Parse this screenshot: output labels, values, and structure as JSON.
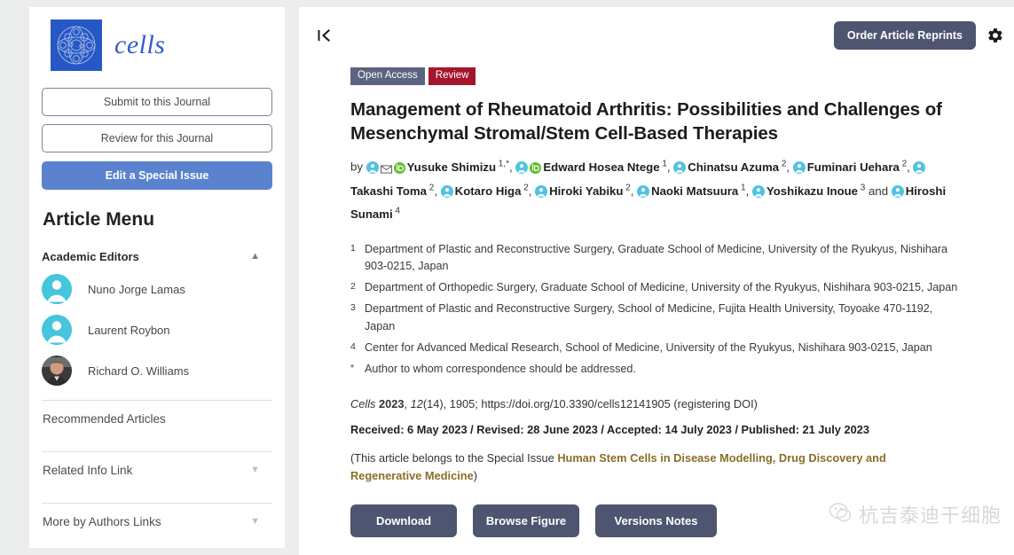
{
  "journal": {
    "logo_word": "cells",
    "logo_icon": "cell-cluster-logo"
  },
  "sidebar": {
    "buttons": {
      "submit": "Submit to this Journal",
      "review": "Review for this Journal",
      "edit_special_issue": "Edit a Special Issue"
    },
    "article_menu_title": "Article Menu",
    "academic_editors": {
      "label": "Academic Editors",
      "chevron": "chevron-up",
      "editors": [
        {
          "name": "Nuno Jorge Lamas",
          "avatar": "default-person-avatar"
        },
        {
          "name": "Laurent Roybon",
          "avatar": "default-person-avatar"
        },
        {
          "name": "Richard O. Williams",
          "avatar": "photo-avatar"
        }
      ]
    },
    "menu_links": [
      {
        "label": "Recommended Articles",
        "chevron": ""
      },
      {
        "label": "Related Info Link",
        "chevron": "chevron-down"
      },
      {
        "label": "More by Authors Links",
        "chevron": "chevron-down"
      }
    ]
  },
  "toolbar": {
    "collapse_icon": "collapse-left-icon",
    "reprints_label": "Order Article Reprints",
    "settings_icon": "gear-icon"
  },
  "article": {
    "badges": [
      {
        "label": "Open Access",
        "color": "#5a6480"
      },
      {
        "label": "Review",
        "color": "#a3162b"
      }
    ],
    "title": "Management of Rheumatoid Arthritis: Possibilities and Challenges of Mesenchymal Stromal/Stem Cell-Based Therapies",
    "by_label": "by",
    "authors": [
      {
        "name": "Yusuke Shimizu",
        "sup": "1,*",
        "icons": [
          "person-icon",
          "envelope-icon",
          "orcid-icon"
        ],
        "sep": ", "
      },
      {
        "name": "Edward Hosea Ntege",
        "sup": "1",
        "icons": [
          "person-icon",
          "orcid-icon"
        ],
        "sep": ", "
      },
      {
        "name": "Chinatsu Azuma",
        "sup": "2",
        "icons": [
          "person-icon"
        ],
        "sep": ", "
      },
      {
        "name": "Fuminari Uehara",
        "sup": "2",
        "icons": [
          "person-icon"
        ],
        "sep": ", "
      },
      {
        "name": "Takashi Toma",
        "sup": "2",
        "icons": [
          "person-icon"
        ],
        "sep": ", "
      },
      {
        "name": "Kotaro Higa",
        "sup": "2",
        "icons": [
          "person-icon"
        ],
        "sep": ", "
      },
      {
        "name": "Hiroki Yabiku",
        "sup": "2",
        "icons": [
          "person-icon"
        ],
        "sep": ", "
      },
      {
        "name": "Naoki Matsuura",
        "sup": "1",
        "icons": [
          "person-icon"
        ],
        "sep": ", "
      },
      {
        "name": "Yoshikazu Inoue",
        "sup": "3",
        "icons": [
          "person-icon"
        ],
        "sep": " and "
      },
      {
        "name": "Hiroshi Sunami",
        "sup": "4",
        "icons": [
          "person-icon"
        ],
        "sep": ""
      }
    ],
    "affiliations": [
      {
        "num": "1",
        "text": "Department of Plastic and Reconstructive Surgery, Graduate School of Medicine, University of the Ryukyus, Nishihara 903-0215, Japan"
      },
      {
        "num": "2",
        "text": "Department of Orthopedic Surgery, Graduate School of Medicine, University of the Ryukyus, Nishihara 903-0215, Japan"
      },
      {
        "num": "3",
        "text": "Department of Plastic and Reconstructive Surgery, School of Medicine, Fujita Health University, Toyoake 470-1192, Japan"
      },
      {
        "num": "4",
        "text": "Center for Advanced Medical Research, School of Medicine, University of the Ryukyus, Nishihara 903-0215, Japan"
      },
      {
        "num": "*",
        "text": "Author to whom correspondence should be addressed."
      }
    ],
    "citation": {
      "journal": "Cells",
      "year": "2023",
      "volume": "12",
      "issue": "(14)",
      "article_no": "1905",
      "doi": "https://doi.org/10.3390/cells12141905",
      "doi_note": "(registering DOI)",
      "full": "Cells 2023, 12(14), 1905; https://doi.org/10.3390/cells12141905 (registering DOI)"
    },
    "dates": "Received: 6 May 2023 / Revised: 28 June 2023 / Accepted: 14 July 2023 / Published: 21 July 2023",
    "special_issue": {
      "prefix": "(This article belongs to the Special Issue ",
      "link": "Human Stem Cells in Disease Modelling, Drug Discovery and Regenerative Medicine",
      "suffix": ")"
    },
    "actions": [
      {
        "label": "Download"
      },
      {
        "label": "Browse Figure"
      },
      {
        "label": "Versions Notes"
      }
    ]
  },
  "watermark": {
    "icon": "wechat-icon",
    "text": "杭吉泰迪干细胞"
  }
}
